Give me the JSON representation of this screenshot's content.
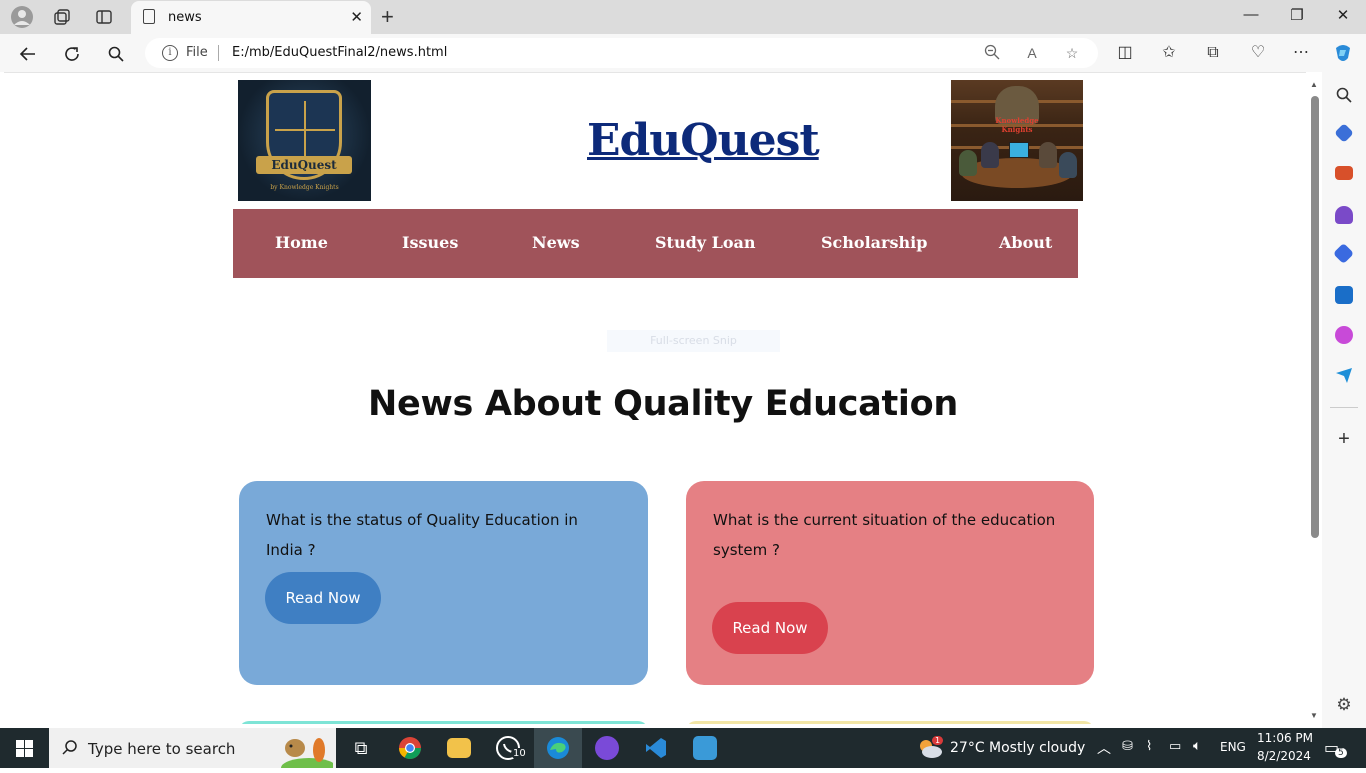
{
  "browser": {
    "tab_title": "news",
    "url_scheme_label": "File",
    "url": "E:/mb/EduQuestFinal2/news.html"
  },
  "site": {
    "title": "EduQuest",
    "logo_banner": "EduQuest",
    "logo_subtitle": "by Knowledge Knights",
    "right_image_text": "Knowledge Knights"
  },
  "nav": {
    "items": [
      {
        "label": "Home"
      },
      {
        "label": "Issues"
      },
      {
        "label": "News"
      },
      {
        "label": "Study Loan"
      },
      {
        "label": "Scholarship"
      },
      {
        "label": "About"
      }
    ]
  },
  "snip_overlay": "Full-screen Snip",
  "page": {
    "heading": "News About Quality Education"
  },
  "cards": [
    {
      "question": "What is the status of Quality Education in India ?",
      "button": "Read Now",
      "bg": "#79a9d8",
      "btn": "#3f7fc3"
    },
    {
      "question": "What is the current situation of the education system ?",
      "button": "Read Now",
      "bg": "#e58084",
      "btn": "#d9424e"
    }
  ],
  "next_cards_colors": [
    "#7ee4d6",
    "#f2e6a6"
  ],
  "taskbar": {
    "search_placeholder": "Type here to search",
    "whatsapp_badge": "10",
    "weather_badge": "1",
    "weather": "27°C  Mostly cloudy",
    "language": "ENG",
    "time": "11:06 PM",
    "date": "8/2/2024",
    "notification_count": "5"
  }
}
